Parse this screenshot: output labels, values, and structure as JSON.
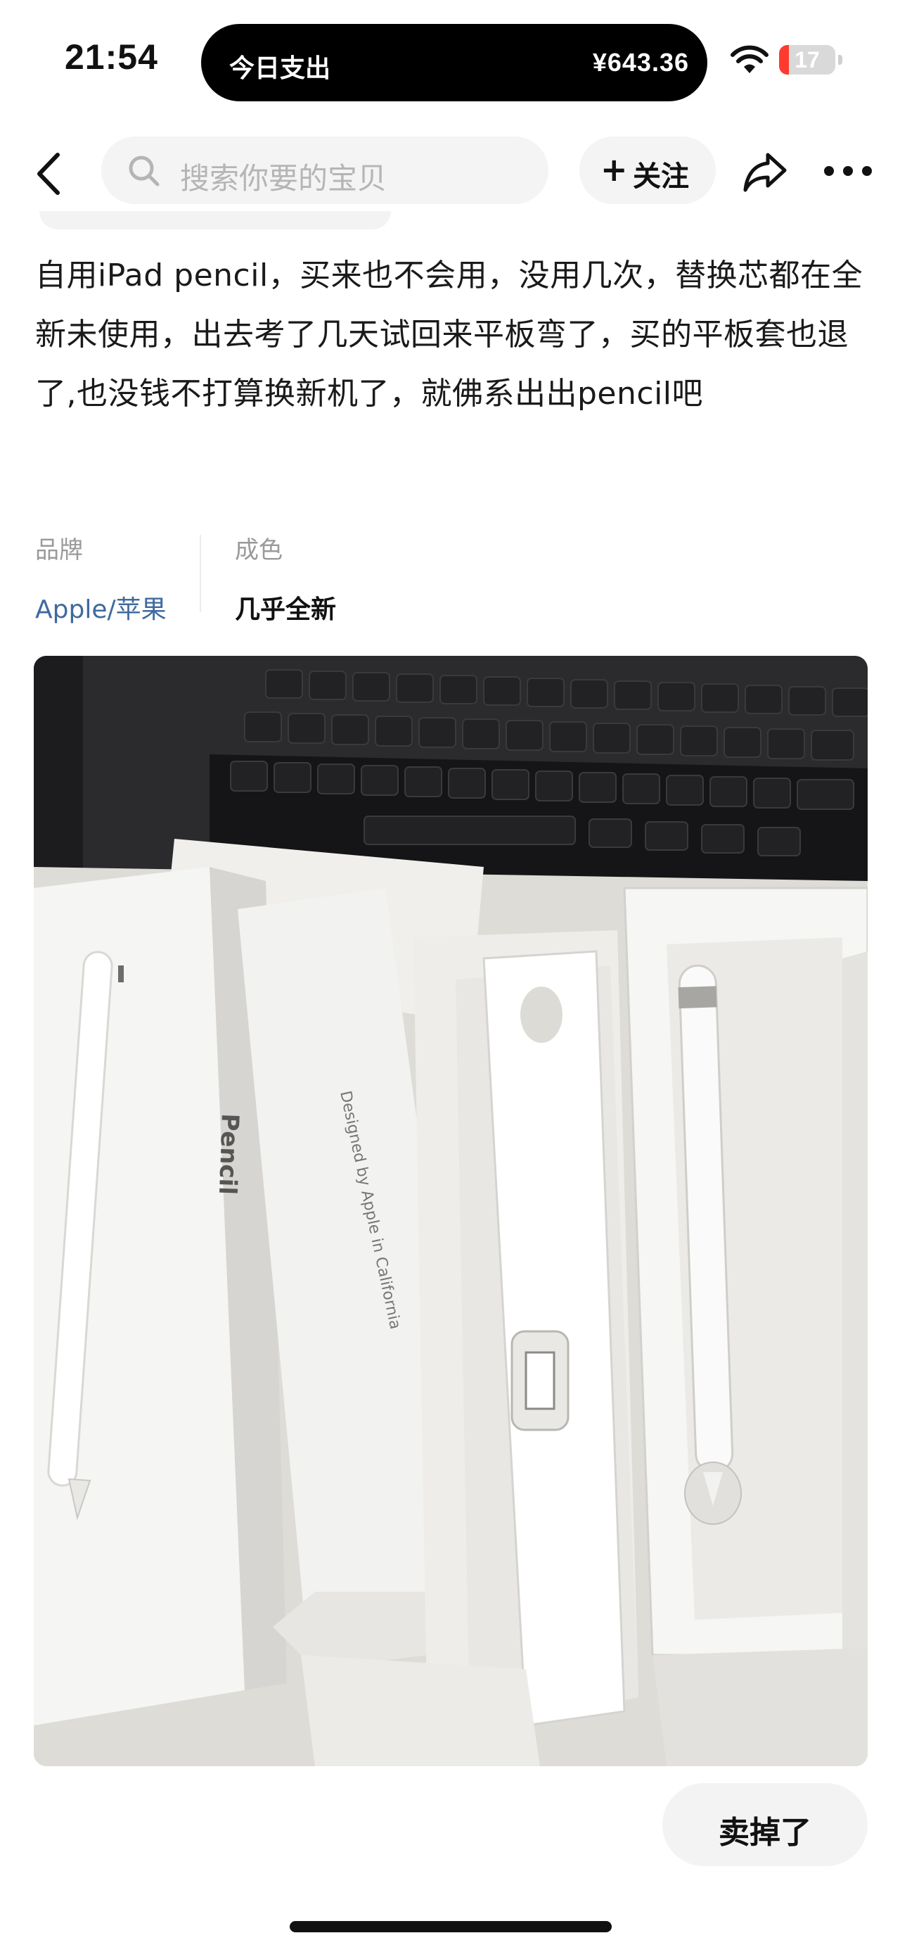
{
  "status_bar": {
    "time": "21:54",
    "island_label": "今日支出",
    "island_amount": "¥643.36",
    "battery_level": "17",
    "battery_fraction": 0.17,
    "wifi_icon": "wifi-icon"
  },
  "nav": {
    "back_icon": "chevron-left-icon",
    "search_placeholder": "搜索你要的宝贝",
    "follow_plus": "+",
    "follow_label": "关注",
    "share_icon": "share-icon",
    "more_icon": "more-dots-icon"
  },
  "item": {
    "description": "自用iPad pencil，买来也不会用，没用几次，替换芯都在全新未使用，出去考了几天试回来平板弯了，买的平板套也退了,也没钱不打算换新机了，就佛系出出pencil吧",
    "attributes": [
      {
        "label": "品牌",
        "value": "Apple/苹果"
      },
      {
        "label": "成色",
        "value": "几乎全新"
      }
    ],
    "photo_text": {
      "box_brand": "Pencil",
      "box_caption": "Designed by Apple in California"
    }
  },
  "actions": {
    "sold_label": "卖掉了"
  },
  "colors": {
    "brand_value": "#3f6a9e",
    "battery_low": "#ff3b30",
    "pill_bg": "#f4f4f4"
  }
}
